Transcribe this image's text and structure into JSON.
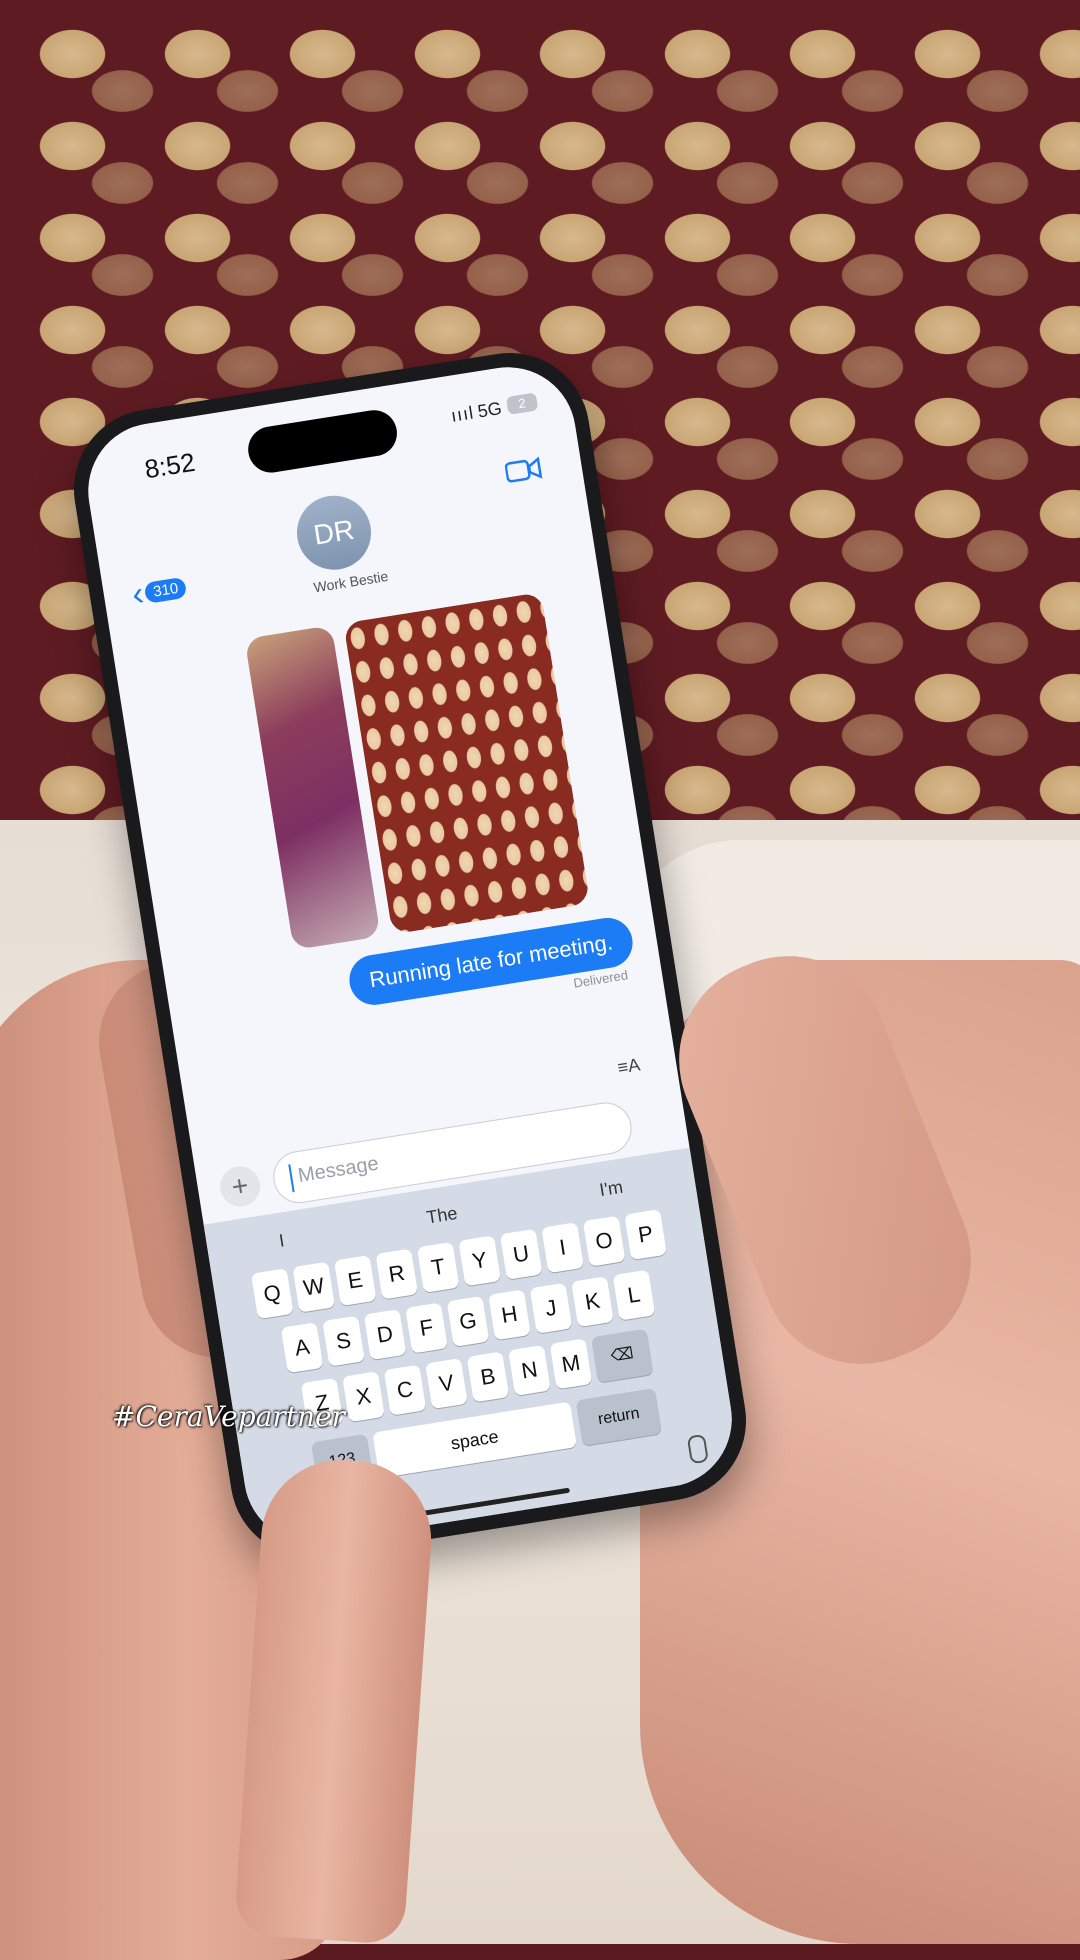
{
  "status_bar": {
    "time": "8:52",
    "signal": "ıııl",
    "network": "5G",
    "battery": "2"
  },
  "header": {
    "avatar_initials": "DR",
    "contact_name": "Work Bestie",
    "back_badge": "310",
    "back_chevron": "‹"
  },
  "conversation": {
    "sent_message": "Running late for meeting.",
    "status": "Delivered"
  },
  "composer": {
    "plus_label": "+",
    "placeholder": "Message",
    "format_label": "≡A"
  },
  "keyboard": {
    "suggestions": [
      "I",
      "The",
      "I'm"
    ],
    "row1": [
      "Q",
      "W",
      "E",
      "R",
      "T",
      "Y",
      "U",
      "I",
      "O",
      "P"
    ],
    "row2": [
      "A",
      "S",
      "D",
      "F",
      "G",
      "H",
      "J",
      "K",
      "L"
    ],
    "row3": [
      "Z",
      "X",
      "C",
      "V",
      "B",
      "N",
      "M"
    ],
    "delete_label": "⌫",
    "numbers_label": "123",
    "space_label": "space",
    "return_label": "return"
  },
  "overlay": {
    "hashtag": "#CeraVepartner"
  },
  "colors": {
    "accent": "#1b7cf5",
    "fabric": "#5e1b22",
    "dots": "#d7b98e"
  }
}
